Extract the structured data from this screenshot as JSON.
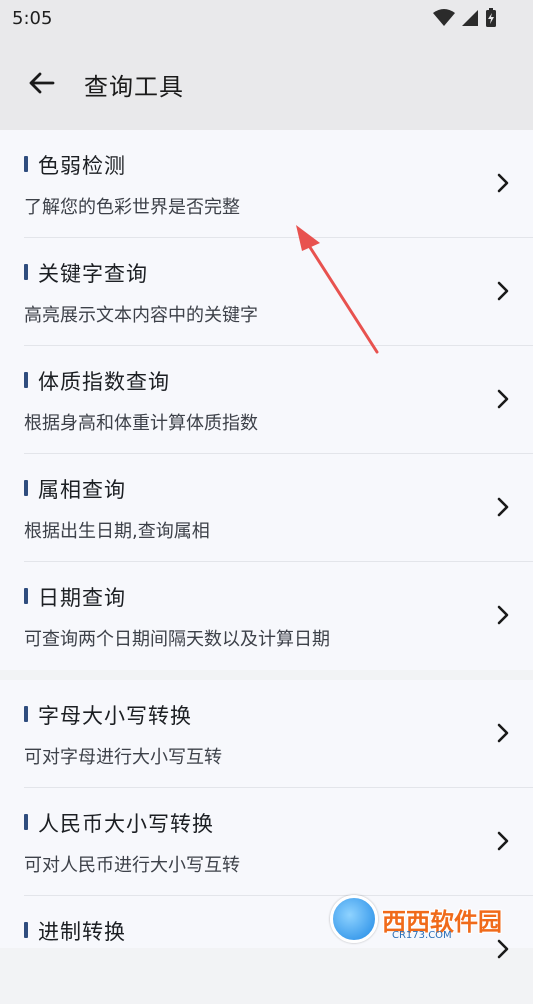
{
  "status_bar": {
    "time": "5:05"
  },
  "app_bar": {
    "title": "查询工具"
  },
  "group1": [
    {
      "title": "色弱检测",
      "desc": "了解您的色彩世界是否完整"
    },
    {
      "title": "关键字查询",
      "desc": "高亮展示文本内容中的关键字"
    },
    {
      "title": "体质指数查询",
      "desc": "根据身高和体重计算体质指数"
    },
    {
      "title": "属相查询",
      "desc": "根据出生日期,查询属相"
    },
    {
      "title": "日期查询",
      "desc": "可查询两个日期间隔天数以及计算日期"
    }
  ],
  "group2": [
    {
      "title": "字母大小写转换",
      "desc": "可对字母进行大小写互转"
    },
    {
      "title": "人民币大小写转换",
      "desc": "可对人民币进行大小写互转"
    },
    {
      "title": "进制转换",
      "desc": ""
    }
  ],
  "watermark": {
    "text": "西西软件园",
    "sub": "CR173.COM"
  },
  "colors": {
    "accent_bar": "#2f4d7e",
    "annotation_arrow": "#e8524f",
    "background": "#f2f3f5"
  }
}
